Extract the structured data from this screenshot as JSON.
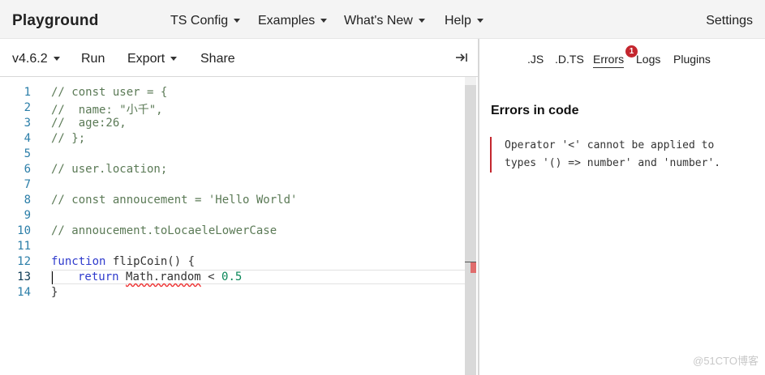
{
  "nav": {
    "brand": "Playground",
    "items": [
      {
        "label": "TS Config"
      },
      {
        "label": "Examples"
      },
      {
        "label": "What's New"
      },
      {
        "label": "Help"
      }
    ],
    "settings": "Settings"
  },
  "toolbar": {
    "version": "v4.6.2",
    "run": "Run",
    "export": "Export",
    "share": "Share"
  },
  "editor": {
    "line_numbers": [
      "1",
      "2",
      "3",
      "4",
      "5",
      "6",
      "7",
      "8",
      "9",
      "10",
      "11",
      "12",
      "13",
      "14"
    ],
    "lines": {
      "l1": "// const user = {",
      "l2": "//  name: \"小千\",",
      "l3": "//  age:26,",
      "l4": "// };",
      "l6": "// user.location;",
      "l8": "// const annoucement = 'Hello World'",
      "l10": "// annoucement.toLocaeleLowerCase",
      "l12_kw": "function",
      "l12_rest": " flipCoin() {",
      "l13_kw": "return",
      "l13_err": "Math.random",
      "l13_op": " < ",
      "l13_num": "0.5",
      "l14": "}"
    }
  },
  "right_tabs": {
    "js": ".JS",
    "dts": ".D.TS",
    "errors": "Errors",
    "badge": "1",
    "logs": "Logs",
    "plugins": "Plugins"
  },
  "errors_panel": {
    "heading": "Errors in code",
    "message": "Operator '<' cannot be applied to types '() => number' and 'number'."
  },
  "watermark": "@51CTO博客",
  "colors": {
    "error_red": "#c4262e",
    "keyword_blue": "#2f3bcd",
    "comment_green": "#5b7a56",
    "number_green": "#098658",
    "line_number_blue": "#2b7ea8"
  }
}
